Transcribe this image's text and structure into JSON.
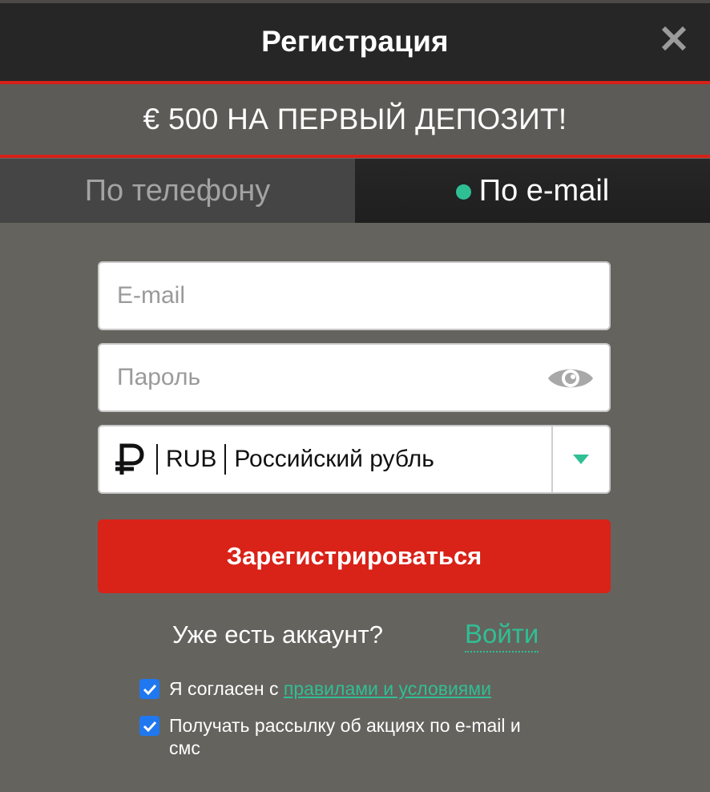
{
  "header": {
    "title": "Регистрация"
  },
  "promo": {
    "text": "€ 500 НА ПЕРВЫЙ ДЕПОЗИТ!"
  },
  "tabs": [
    {
      "label": "По телефону",
      "active": false
    },
    {
      "label": "По e-mail",
      "active": true
    }
  ],
  "form": {
    "email_placeholder": "E-mail",
    "email_value": "",
    "password_placeholder": "Пароль",
    "password_value": "",
    "currency": {
      "symbol_icon": "ruble-icon",
      "code": "RUB",
      "name": "Российский рубль"
    },
    "register_label": "Зарегистрироваться"
  },
  "account": {
    "question": "Уже есть аккаунт?",
    "login_label": "Войти"
  },
  "consents": {
    "terms_prefix": "Я согласен с ",
    "terms_link": "правилами и условиями",
    "newsletter": "Получать рассылку об акциях по e-mail и смс"
  },
  "colors": {
    "accent_red": "#d92218",
    "accent_green": "#2fbf94",
    "checkbox_blue": "#1f78f0",
    "header_bg": "#262626",
    "modal_bg": "#65635e"
  }
}
